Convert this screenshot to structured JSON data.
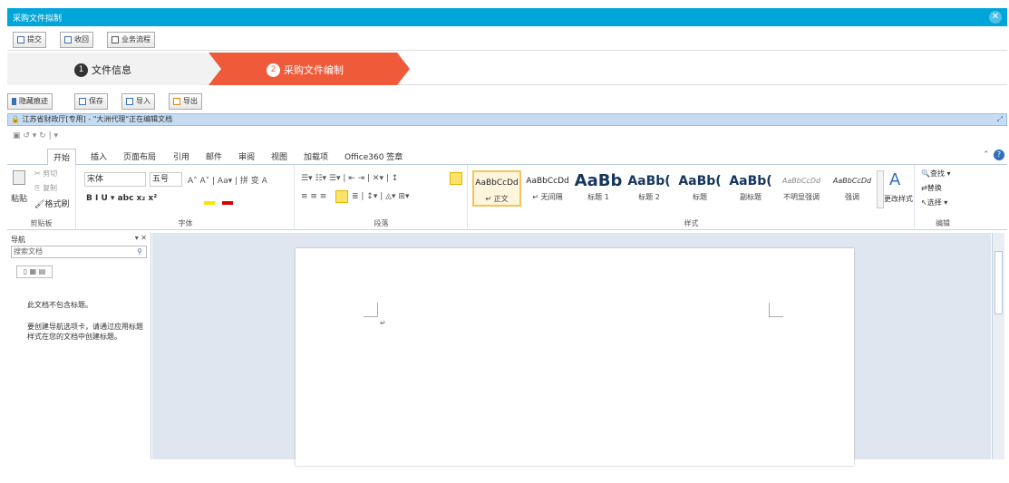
{
  "window": {
    "title": "采购文件拟制",
    "close_icon": "close-icon"
  },
  "toolbar1": {
    "items": [
      "提交",
      "收回",
      "业务流程"
    ]
  },
  "stepper": {
    "step1_num": "1",
    "step1_label": "文件信息",
    "step2_num": "2",
    "step2_label": "采购文件编制",
    "active_color": "#ef5b3a"
  },
  "toolbar2": {
    "items": [
      "隐藏痕迹",
      "保存",
      "导入",
      "导出"
    ]
  },
  "word": {
    "title": "江苏省财政厅[专用] - \"大洲代理\"正在编辑文档",
    "qat": "↺ ▾ ↻ | ▾",
    "tabs": [
      "开始",
      "插入",
      "页面布局",
      "引用",
      "邮件",
      "审阅",
      "视图",
      "加载项",
      "Office360 签章"
    ],
    "clipboard": {
      "paste": "粘贴",
      "cut": "剪切",
      "copy": "复制",
      "format_painter": "格式刷",
      "label": "剪贴板"
    },
    "font": {
      "name": "宋体",
      "size": "五号",
      "label": "字体"
    },
    "paragraph": {
      "label": "段落"
    },
    "styles": {
      "label": "样式",
      "items": [
        {
          "preview": "AaBbCcDd",
          "name": "↵ 正文"
        },
        {
          "preview": "AaBbCcDd",
          "name": "↵ 无间隔"
        },
        {
          "preview": "AaBb",
          "name": "标题 1"
        },
        {
          "preview": "AaBb(",
          "name": "标题 2"
        },
        {
          "preview": "AaBb(",
          "name": "标题"
        },
        {
          "preview": "AaBb(",
          "name": "副标题"
        },
        {
          "preview": "AaBbCcDd",
          "name": "不明显强调"
        },
        {
          "preview": "AaBbCcDd",
          "name": "强调"
        }
      ],
      "change": "更改样式"
    },
    "editing": {
      "find": "查找 ▾",
      "replace": "替换",
      "select": "选择 ▾",
      "label": "编辑"
    }
  },
  "nav": {
    "title": "导航",
    "search_placeholder": "搜索文档",
    "msg1": "此文档不包含标题。",
    "msg2": "要创建导航选项卡，请通过应用标题样式在您的文档中创建标题。"
  }
}
